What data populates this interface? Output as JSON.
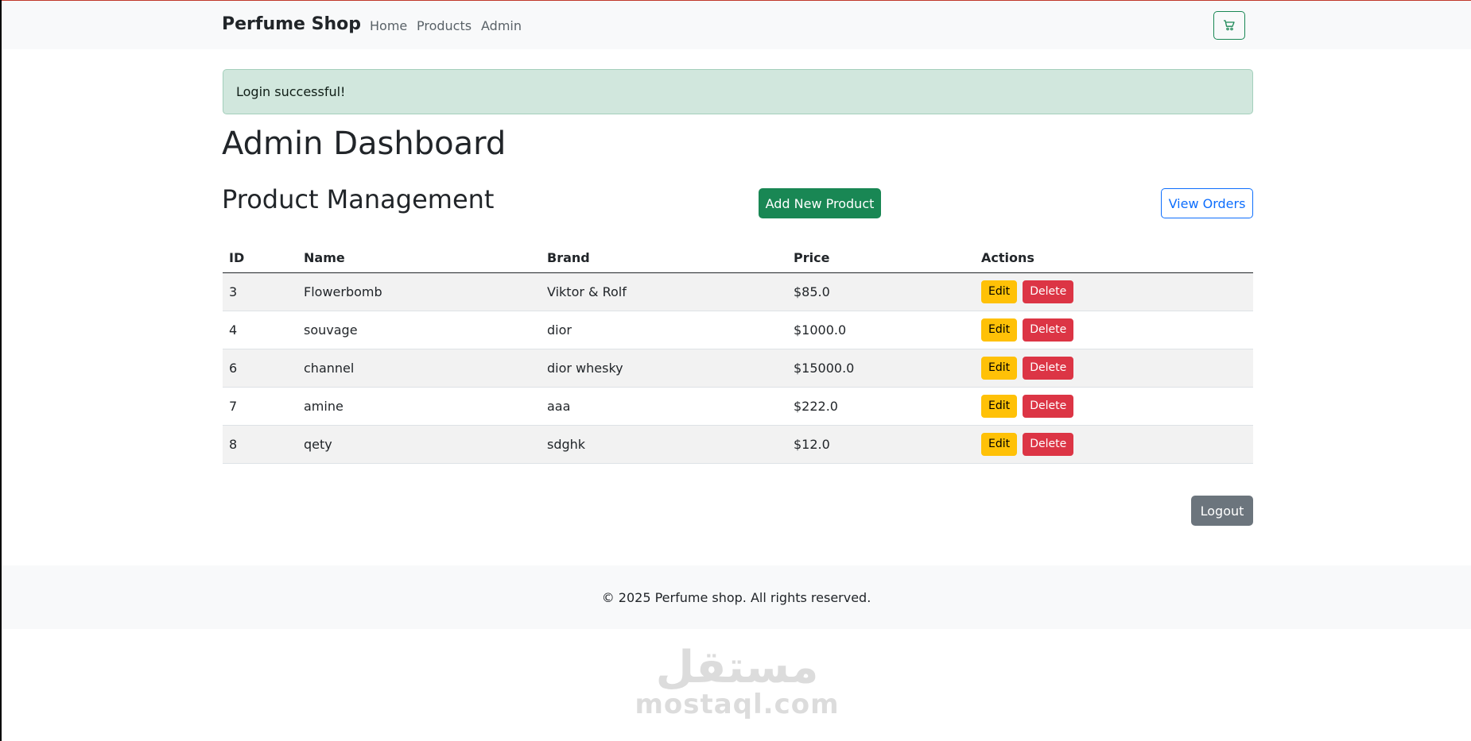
{
  "navbar": {
    "brand": "Perfume Shop",
    "links": [
      "Home",
      "Products",
      "Admin"
    ],
    "cart_icon": "cart-icon"
  },
  "alert": {
    "message": "Login successful!"
  },
  "page": {
    "title": "Admin Dashboard",
    "section_title": "Product Management",
    "add_button": "Add New Product",
    "orders_button": "View Orders",
    "logout_button": "Logout"
  },
  "table": {
    "headers": [
      "ID",
      "Name",
      "Brand",
      "Price",
      "Actions"
    ],
    "rows": [
      {
        "id": "3",
        "name": "Flowerbomb",
        "brand": "Viktor & Rolf",
        "price": "$85.0"
      },
      {
        "id": "4",
        "name": "souvage",
        "brand": "dior",
        "price": "$1000.0"
      },
      {
        "id": "6",
        "name": "channel",
        "brand": "dior whesky",
        "price": "$15000.0"
      },
      {
        "id": "7",
        "name": "amine",
        "brand": "aaa",
        "price": "$222.0"
      },
      {
        "id": "8",
        "name": "qety",
        "brand": "sdghk",
        "price": "$12.0"
      }
    ],
    "edit_label": "Edit",
    "delete_label": "Delete"
  },
  "footer": {
    "text": "© 2025 Perfume shop. All rights reserved."
  },
  "watermark": {
    "arabic": "مستقل",
    "latin": "mostaql.com"
  },
  "colors": {
    "success": "#198754",
    "primary": "#0d6efd",
    "warning": "#ffc107",
    "danger": "#dc3545",
    "secondary": "#6c757d",
    "alert_bg": "#d1e7dd"
  }
}
